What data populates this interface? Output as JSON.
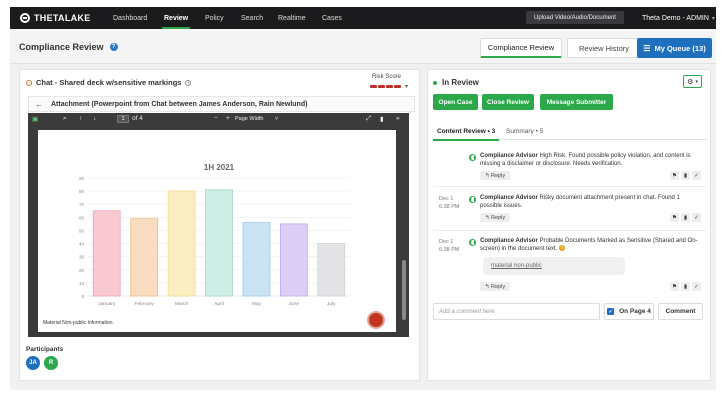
{
  "nav": {
    "logo": "THETALAKE",
    "items": [
      {
        "label": "Dashboard",
        "active": false
      },
      {
        "label": "Review",
        "active": true
      },
      {
        "label": "Policy",
        "active": false
      },
      {
        "label": "Search",
        "active": false
      },
      {
        "label": "Realtime",
        "active": false
      },
      {
        "label": "Cases",
        "active": false
      }
    ],
    "upload_label": "Upload Video/Audio/Document",
    "user_label": "Theta Demo - ADMIN"
  },
  "header": {
    "title": "Compliance Review",
    "help_icon": "question-icon",
    "tabs": [
      "Compliance Review",
      "Review History"
    ],
    "queue_label": "My Queue (13)"
  },
  "left": {
    "chat_title": "Chat - Shared deck w/sensitive markings",
    "risk_label": "Risk Score",
    "risk_level": 4,
    "risk_color": "#c0302a",
    "attachment_title": "Attachment (Powerpoint from Chat between James Anderson, Rain Newlund)",
    "viewer": {
      "page_current": "1",
      "page_total": "of 4",
      "zoom_label": "Page Width",
      "zoom_caret": "˅"
    },
    "footer_note": "Material Non-public Information.",
    "participants_label": "Participants",
    "participants": [
      {
        "initials": "JA",
        "color": "#1f6fbf"
      },
      {
        "initials": "R",
        "color": "#2aa84a"
      }
    ]
  },
  "chart_data": {
    "type": "bar",
    "title": "1H 2021",
    "categories": [
      "January",
      "February",
      "March",
      "April",
      "May",
      "June",
      "July"
    ],
    "values": [
      65,
      59,
      80,
      81,
      56,
      55,
      40
    ],
    "colors": [
      "#f9c9d2",
      "#fbdcc0",
      "#fbeec2",
      "#cfeee6",
      "#c9e3f5",
      "#dccff7",
      "#e4e4e6"
    ],
    "borders": [
      "#f1a0b1",
      "#f3bb8c",
      "#f4d98a",
      "#9ed9c9",
      "#9bc9ec",
      "#bda8f0",
      "#cfcfd3"
    ],
    "yticks": [
      0,
      10,
      20,
      30,
      40,
      50,
      60,
      70,
      80,
      90
    ],
    "ylim": [
      0,
      90
    ],
    "grid": true
  },
  "right": {
    "status": "In Review",
    "status_color": "#2aa84a",
    "actions": [
      "Open Case",
      "Close Review",
      "Message Submitter"
    ],
    "tabs": [
      {
        "label": "Content Review • 3",
        "active": true
      },
      {
        "label": "Summary • 5",
        "active": false
      }
    ],
    "comments": [
      {
        "date": "",
        "time": "",
        "author": "Compliance Advisor",
        "text": "High Risk. Found possible policy violation, and content is missing a disclaimer or disclosure. Needs verification.",
        "reply": "Reply"
      },
      {
        "date": "Dec 1",
        "time": "6:38 PM",
        "author": "Compliance Advisor",
        "text": "Risky document attachment present in chat. Found 1 possible issues.",
        "reply": "Reply"
      },
      {
        "date": "Dec 1",
        "time": "6:38 PM",
        "author": "Compliance Advisor",
        "text": "Probable Documents Marked as Sensitive (Shared and On-screen) in the document text.",
        "tag": "material non-public",
        "reply": "Reply"
      }
    ],
    "comment_placeholder": "Add a comment here",
    "on_page_label": "On Page 4",
    "comment_button": "Comment"
  }
}
